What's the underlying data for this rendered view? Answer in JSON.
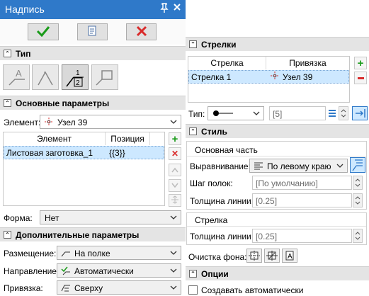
{
  "window": {
    "title": "Надпись",
    "pin_icon": "pin-icon",
    "close_icon": "close-icon"
  },
  "toolbar": {
    "ok_icon": "checkmark-icon",
    "save_icon": "document-icon",
    "cancel_icon": "cross-icon"
  },
  "type_section": {
    "title": "Тип",
    "selected_index": 2
  },
  "main_params": {
    "title": "Основные параметры",
    "element_label": "Элемент:",
    "element_value": "Узел 39",
    "table": {
      "headers": [
        "Элемент",
        "Позиция"
      ],
      "rows": [
        {
          "element": "Листовая заготовка_1",
          "position": "{{3}}"
        }
      ]
    },
    "form_label": "Форма:",
    "form_value": "Нет"
  },
  "extra_params": {
    "title": "Дополнительные параметры",
    "placement_label": "Размещение:",
    "placement_value": "На полке",
    "direction_label": "Направление:",
    "direction_value": "Автоматически",
    "binding_label": "Привязка:",
    "binding_value": "Сверху"
  },
  "arrows": {
    "title": "Стрелки",
    "table": {
      "headers": [
        "Стрелка",
        "Привязка"
      ],
      "rows": [
        {
          "arrow": "Стрелка 1",
          "binding": "Узел 39"
        }
      ]
    },
    "type_label": "Тип:",
    "type_value": "[5]"
  },
  "style": {
    "title": "Стиль",
    "main_part": {
      "title": "Основная часть",
      "align_label": "Выравнивание:",
      "align_value": "По левому краю",
      "shelf_label": "Шаг полок:",
      "shelf_value": "[По умолчанию]",
      "thickness_label": "Толщина линии:",
      "thickness_value": "[0.25]"
    },
    "arrow_part": {
      "title": "Стрелка",
      "thickness_label": "Толщина линии:",
      "thickness_value": "[0.25]"
    },
    "bg_clear_label": "Очистка фона:"
  },
  "options": {
    "title": "Опции",
    "auto_create_label": "Создавать автоматически",
    "auto_create_checked": false
  },
  "colors": {
    "title_bar": "#2f79c9",
    "accent_green": "#1a9b1a",
    "accent_red": "#d92b2b",
    "selection": "#cde8ff"
  }
}
